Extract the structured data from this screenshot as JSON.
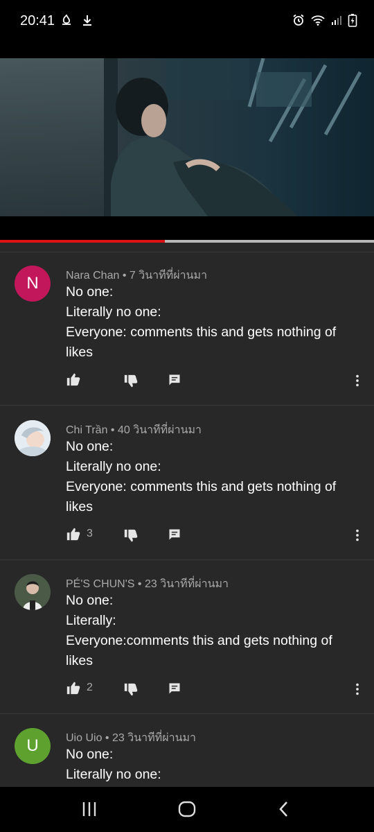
{
  "status_bar": {
    "time": "20:41",
    "icons_left": [
      "notification-icon",
      "download-icon"
    ],
    "icons_right": [
      "alarm-icon",
      "wifi-icon",
      "signal-icon",
      "battery-charging-icon"
    ]
  },
  "player": {
    "progress_fraction": 0.44,
    "colors": {
      "progress": "#dd1111",
      "track": "#b8b8b8"
    }
  },
  "comments": [
    {
      "author": "Nara Chan",
      "time": "7 วินาทีที่ผ่านมา",
      "avatar_letter": "N",
      "avatar_color": "#c2185b",
      "lines": [
        "No one:",
        "Literally no one:",
        "Everyone: comments this and gets nothing of",
        "likes"
      ],
      "likes": ""
    },
    {
      "author": "Chi Trần",
      "time": "40 วินาทีที่ผ่านมา",
      "avatar_letter": "",
      "avatar_color": "#dfe7ee",
      "lines": [
        "No one:",
        "Literally no one:",
        "Everyone: comments this and gets nothing of",
        "likes"
      ],
      "likes": "3"
    },
    {
      "author": "PÉ'S CHUN'S",
      "time": "23 วินาทีที่ผ่านมา",
      "avatar_letter": "",
      "avatar_color": "#2e3b2e",
      "lines": [
        "No one:",
        "Literally:",
        "Everyone:comments this and gets nothing of",
        "likes"
      ],
      "likes": "2"
    },
    {
      "author": "Uio Uio",
      "time": "23 วินาทีที่ผ่านมา",
      "avatar_letter": "U",
      "avatar_color": "#5fa12f",
      "lines": [
        "No one:",
        "Literally no one:"
      ],
      "likes": ""
    }
  ],
  "nav_bar": {
    "icons": [
      "recent-apps-icon",
      "home-icon",
      "back-icon"
    ]
  },
  "colors": {
    "background": "#282828",
    "meta_text": "#aaaaaa",
    "divider": "#3a3a3a"
  }
}
